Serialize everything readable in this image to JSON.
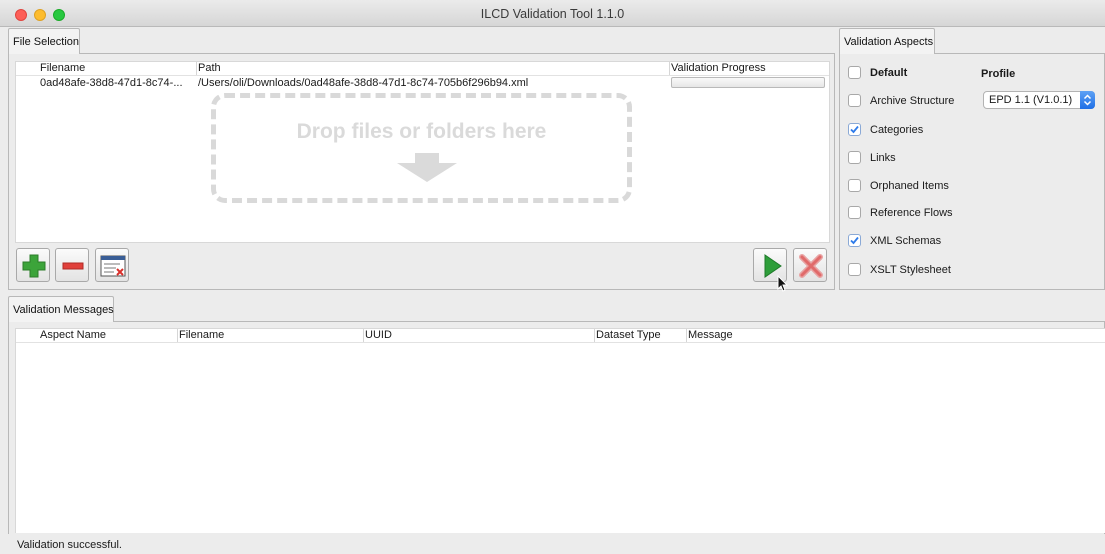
{
  "window": {
    "title": "ILCD Validation Tool 1.1.0"
  },
  "file_selection": {
    "tab_label": "File Selection",
    "columns": [
      "Filename",
      "Path",
      "Validation Progress"
    ],
    "rows": [
      {
        "filename": "0ad48afe-38d8-47d1-8c74-...",
        "path": "/Users/oli/Downloads/0ad48afe-38d8-47d1-8c74-705b6f296b94.xml",
        "progress": 0
      }
    ],
    "drop_zone_text": "Drop files or folders here",
    "toolbar": {
      "add_icon": "plus-icon",
      "remove_icon": "minus-icon",
      "clear_icon": "clear-list-icon",
      "run_icon": "play-icon",
      "cancel_icon": "cancel-x-icon"
    }
  },
  "validation_aspects": {
    "tab_label": "Validation Aspects",
    "default_label": "Default",
    "profile_label": "Profile",
    "profile_value": "EPD 1.1 (V1.0.1)",
    "items": [
      {
        "label": "Archive Structure",
        "checked": false
      },
      {
        "label": "Categories",
        "checked": true
      },
      {
        "label": "Links",
        "checked": false
      },
      {
        "label": "Orphaned Items",
        "checked": false
      },
      {
        "label": "Reference Flows",
        "checked": false
      },
      {
        "label": "XML Schemas",
        "checked": true
      },
      {
        "label": "XSLT Stylesheet",
        "checked": false
      }
    ]
  },
  "validation_messages": {
    "tab_label": "Validation Messages",
    "columns": [
      "Aspect Name",
      "Filename",
      "UUID",
      "Dataset Type",
      "Message"
    ]
  },
  "status": {
    "text": "Validation successful."
  },
  "colors": {
    "checkbox_check": "#2e7bea",
    "run_green": "#2e9e3a",
    "cancel_red": "#e05a5a"
  }
}
